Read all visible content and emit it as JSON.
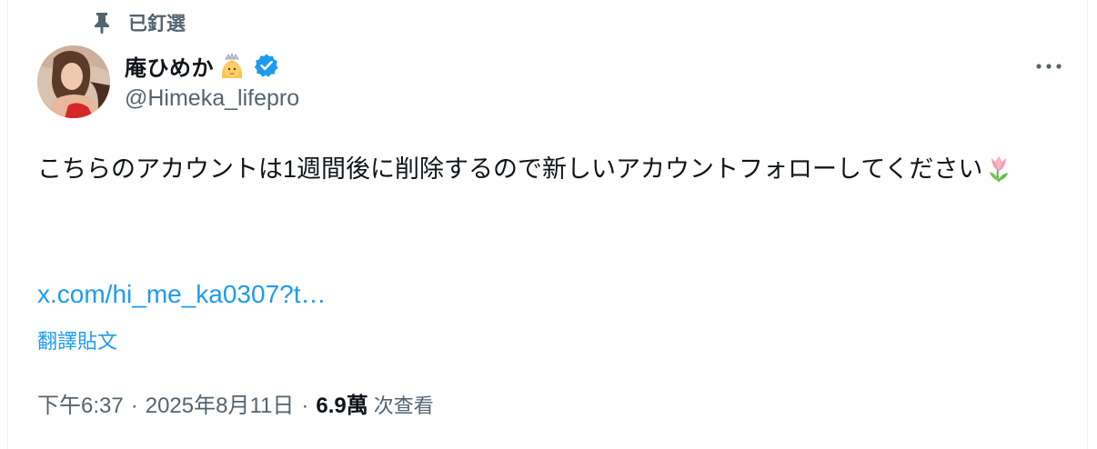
{
  "pinned": {
    "label": "已釘選"
  },
  "author": {
    "display_name": "庵ひめか",
    "handle": "@Himeka_lifepro"
  },
  "tweet": {
    "text": "こちらのアカウントは1週間後に削除するので新しいアカウントフォローしてください",
    "link": "x.com/hi_me_ka0307?t…",
    "translate_label": "翻譯貼文"
  },
  "meta": {
    "time": "下午6:37",
    "sep1": "·",
    "date": "2025年8月11日",
    "sep2": "·",
    "views_count": "6.9萬",
    "views_label": "次查看"
  },
  "icons": {
    "pin": "pin-icon",
    "verified": "verified-badge-icon",
    "more": "more-options-icon",
    "princess": "princess-emoji",
    "tulip": "tulip-emoji"
  },
  "colors": {
    "link": "#1d9bf0",
    "secondary_text": "#536471",
    "primary_text": "#0f1419",
    "verified": "#1d9bf0"
  }
}
